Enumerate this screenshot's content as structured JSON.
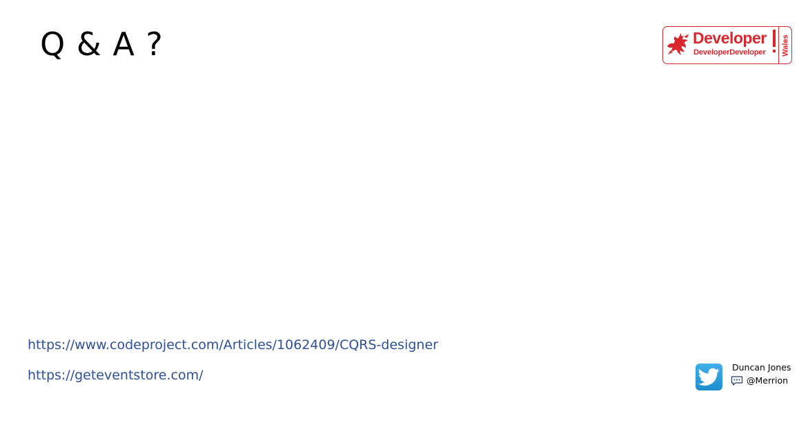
{
  "slide": {
    "title": "Q & A ?"
  },
  "logo": {
    "brand_main": "Developer",
    "brand_sub": "DeveloperDeveloper",
    "region": "Wales",
    "icon": "welsh-dragon-icon",
    "accent_color": "#d8282e"
  },
  "links": [
    {
      "text": "https://www.codeproject.com/Articles/1062409/CQRS-designer"
    },
    {
      "text": "https://geteventstore.com/"
    }
  ],
  "author": {
    "name": "Duncan Jones",
    "handle": "@Merrion",
    "bird_icon": "twitter-bird-icon",
    "chat_icon": "speech-bubble-icon",
    "badge_color": "#2a9fe0"
  },
  "colors": {
    "link": "#2e4f9c",
    "title": "#000000"
  }
}
